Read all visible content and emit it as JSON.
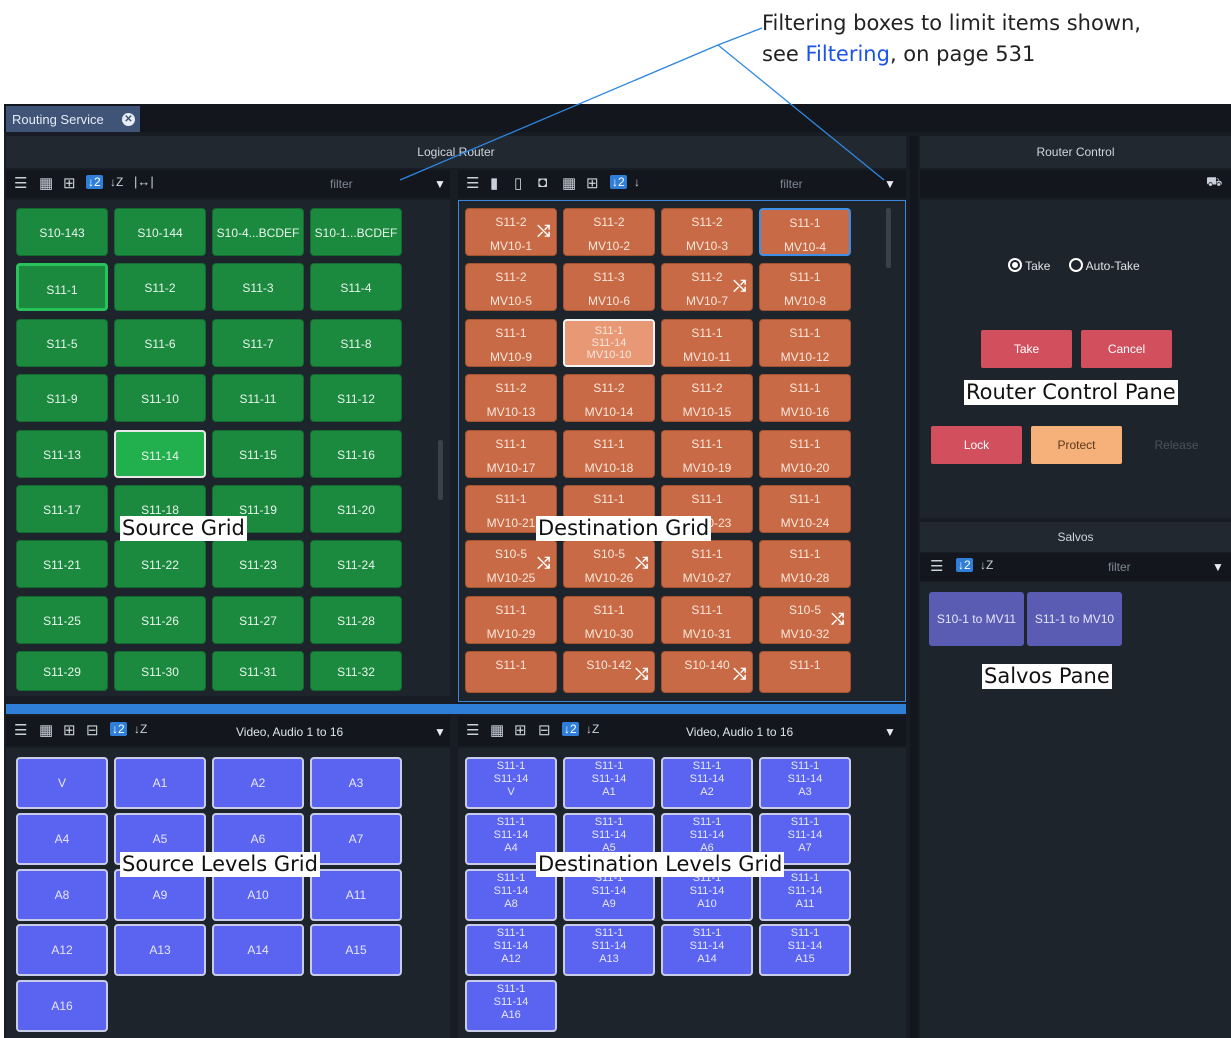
{
  "callout": {
    "line1": "Filtering boxes to limit items shown,",
    "line2_prefix": "see ",
    "link": "Filtering",
    "line2_suffix": ", on page 531"
  },
  "tab": {
    "label": "Routing Service"
  },
  "logical_router": {
    "title": "Logical Router"
  },
  "router_control": {
    "title": "Router Control"
  },
  "source_toolbar": {
    "filter_placeholder": "filter"
  },
  "dest_toolbar": {
    "filter_placeholder": "filter"
  },
  "source_grid": [
    "S10-143",
    "S10-144",
    "S10-4...BCDEF",
    "S10-1...BCDEF",
    "S11-1",
    "S11-2",
    "S11-3",
    "S11-4",
    "S11-5",
    "S11-6",
    "S11-7",
    "S11-8",
    "S11-9",
    "S11-10",
    "S11-11",
    "S11-12",
    "S11-13",
    "S11-14",
    "S11-15",
    "S11-16",
    "S11-17",
    "S11-18",
    "S11-19",
    "S11-20",
    "S11-21",
    "S11-22",
    "S11-23",
    "S11-24",
    "S11-25",
    "S11-26",
    "S11-27",
    "S11-28",
    "S11-29",
    "S11-30",
    "S11-31",
    "S11-32"
  ],
  "dest_grid": [
    {
      "src": "S11-2",
      "dst": "MV10-1"
    },
    {
      "src": "S11-2",
      "dst": "MV10-2"
    },
    {
      "src": "S11-2",
      "dst": "MV10-3"
    },
    {
      "src": "S11-1",
      "dst": "MV10-4"
    },
    {
      "src": "S11-2",
      "dst": "MV10-5"
    },
    {
      "src": "S11-3",
      "dst": "MV10-6"
    },
    {
      "src": "S11-2",
      "dst": "MV10-7"
    },
    {
      "src": "S11-1",
      "dst": "MV10-8"
    },
    {
      "src": "S11-1",
      "dst": "MV10-9"
    },
    {
      "src": "S11-1",
      "mid": "S11-14",
      "dst": "MV10-10"
    },
    {
      "src": "S11-1",
      "dst": "MV10-11"
    },
    {
      "src": "S11-1",
      "dst": "MV10-12"
    },
    {
      "src": "S11-2",
      "dst": "MV10-13"
    },
    {
      "src": "S11-2",
      "dst": "MV10-14"
    },
    {
      "src": "S11-2",
      "dst": "MV10-15"
    },
    {
      "src": "S11-1",
      "dst": "MV10-16"
    },
    {
      "src": "S11-1",
      "dst": "MV10-17"
    },
    {
      "src": "S11-1",
      "dst": "MV10-18"
    },
    {
      "src": "S11-1",
      "dst": "MV10-19"
    },
    {
      "src": "S11-1",
      "dst": "MV10-20"
    },
    {
      "src": "S11-1",
      "dst": "MV10-21"
    },
    {
      "src": "S11-1",
      "dst": "MV10-22"
    },
    {
      "src": "S11-1",
      "dst": "MV10-23"
    },
    {
      "src": "S11-1",
      "dst": "MV10-24"
    },
    {
      "src": "S10-5",
      "dst": "MV10-25"
    },
    {
      "src": "S10-5",
      "dst": "MV10-26"
    },
    {
      "src": "S11-1",
      "dst": "MV10-27"
    },
    {
      "src": "S11-1",
      "dst": "MV10-28"
    },
    {
      "src": "S11-1",
      "dst": "MV10-29"
    },
    {
      "src": "S11-1",
      "dst": "MV10-30"
    },
    {
      "src": "S11-1",
      "dst": "MV10-31"
    },
    {
      "src": "S10-5",
      "dst": "MV10-32"
    },
    {
      "src": "S11-1",
      "dst": ""
    },
    {
      "src": "S10-142",
      "dst": ""
    },
    {
      "src": "S10-140",
      "dst": ""
    },
    {
      "src": "S11-1",
      "dst": ""
    }
  ],
  "levels_filter": {
    "source": "Video, Audio 1 to 16",
    "dest": "Video, Audio 1 to 16"
  },
  "source_levels": [
    "V",
    "A1",
    "A2",
    "A3",
    "A4",
    "A5",
    "A6",
    "A7",
    "A8",
    "A9",
    "A10",
    "A11",
    "A12",
    "A13",
    "A14",
    "A15",
    "A16"
  ],
  "dest_levels": [
    "V",
    "A1",
    "A2",
    "A3",
    "A4",
    "A5",
    "A6",
    "A7",
    "A8",
    "A9",
    "A10",
    "A11",
    "A12",
    "A13",
    "A14",
    "A15",
    "A16"
  ],
  "dest_level_line1": "S11-1",
  "dest_level_line2": "S11-14",
  "controls": {
    "take_radio": "Take",
    "auto_take_radio": "Auto-Take",
    "take": "Take",
    "cancel": "Cancel",
    "lock": "Lock",
    "protect": "Protect",
    "release": "Release"
  },
  "salvos": {
    "title": "Salvos",
    "filter_placeholder": "filter",
    "items": [
      "S10-1 to MV11",
      "S11-1 to MV10"
    ]
  },
  "annotations": {
    "source_grid": "Source Grid",
    "destination_grid": "Destination Grid",
    "source_levels": "Source Levels Grid",
    "destination_levels": "Destination Levels Grid",
    "router_control": "Router Control Pane",
    "salvos": "Salvos Pane"
  },
  "colors": {
    "source": "#1b8a3f",
    "destination": "#c86a45",
    "level": "#5a64f0",
    "take": "#d2505e",
    "protect": "#f6b07a",
    "salvo": "#5a5bb3"
  }
}
